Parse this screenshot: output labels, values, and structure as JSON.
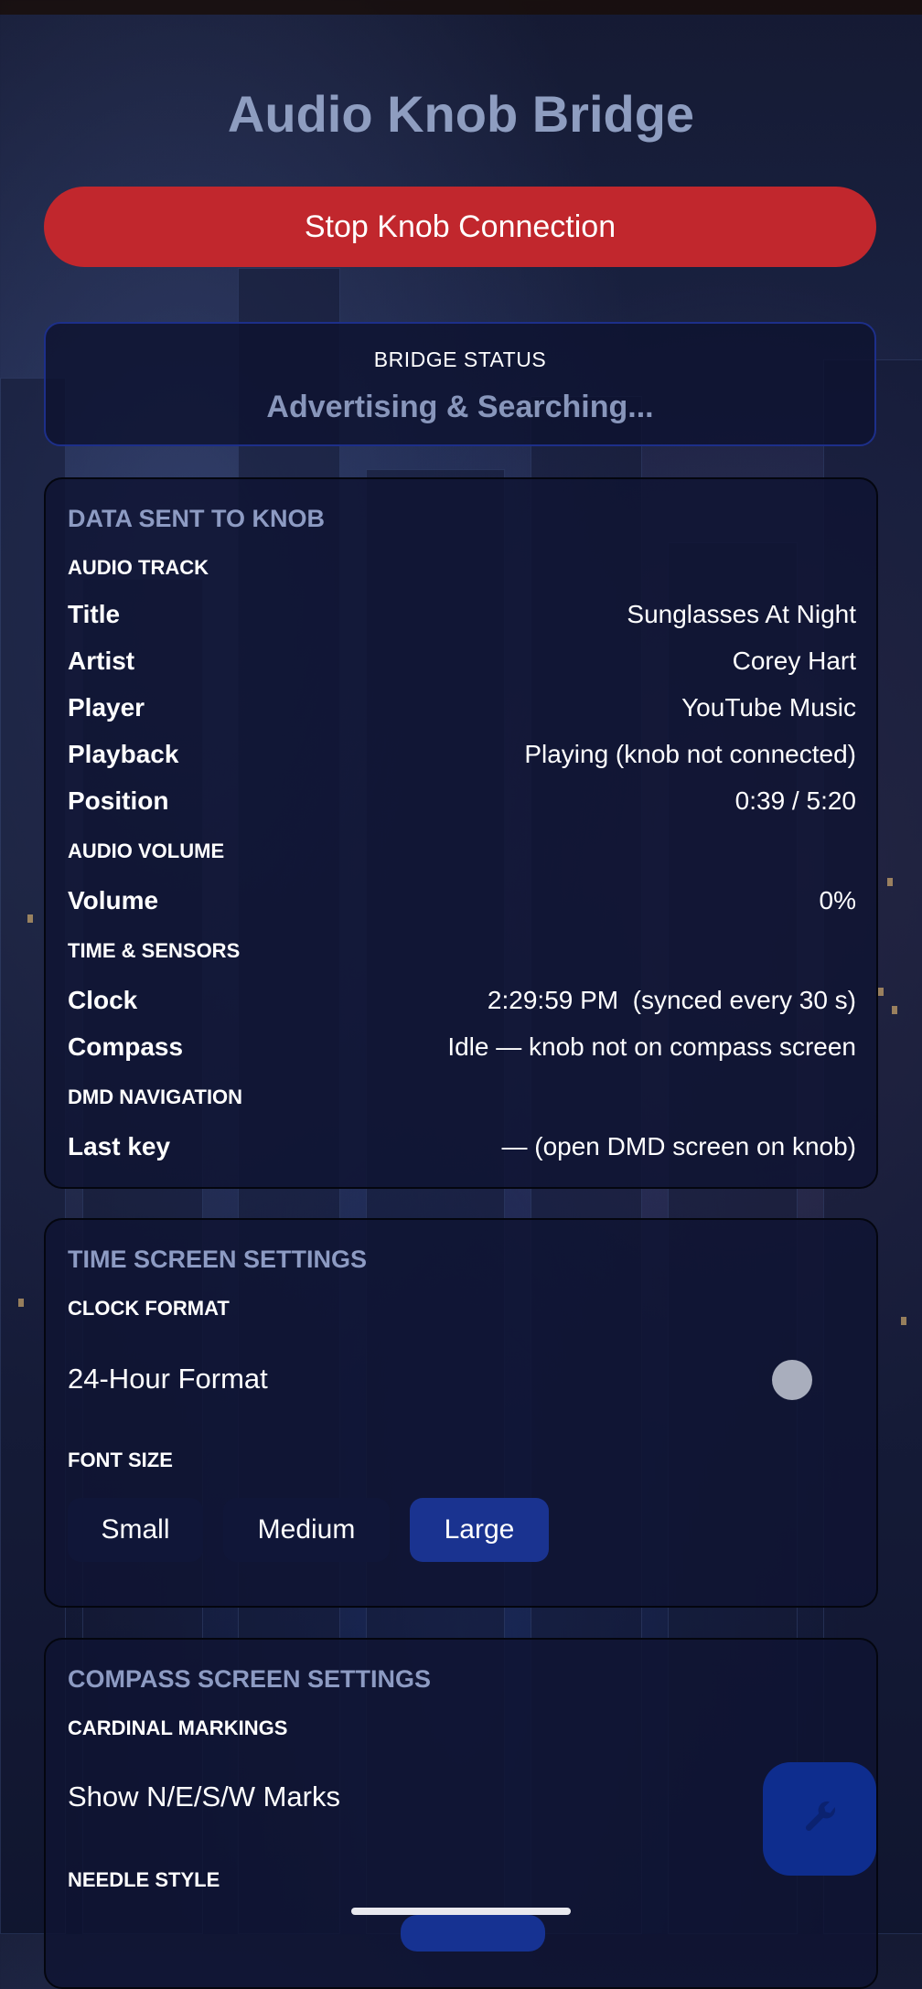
{
  "app": {
    "title": "Audio Knob Bridge",
    "stop_button_label": "Stop Knob Connection"
  },
  "bridge_status": {
    "label": "BRIDGE STATUS",
    "value": "Advertising & Searching..."
  },
  "data_sent": {
    "heading": "DATA SENT TO KNOB",
    "audio_track": {
      "label": "AUDIO TRACK",
      "rows": [
        {
          "label": "Title",
          "value": "Sunglasses At Night"
        },
        {
          "label": "Artist",
          "value": "Corey Hart"
        },
        {
          "label": "Player",
          "value": "YouTube Music"
        },
        {
          "label": "Playback",
          "value": "Playing (knob not connected)"
        },
        {
          "label": "Position",
          "value": "0:39 / 5:20"
        }
      ]
    },
    "audio_volume": {
      "label": "AUDIO VOLUME",
      "rows": [
        {
          "label": "Volume",
          "value": "0%"
        }
      ]
    },
    "time_sensors": {
      "label": "TIME & SENSORS",
      "rows": [
        {
          "label": "Clock",
          "value": "2:29:59 PM  (synced every 30 s)"
        },
        {
          "label": "Compass",
          "value": "Idle — knob not on compass screen"
        }
      ]
    },
    "dmd_navigation": {
      "label": "DMD NAVIGATION",
      "rows": [
        {
          "label": "Last key",
          "value": "— (open DMD screen on knob)"
        }
      ]
    }
  },
  "time_screen": {
    "heading": "TIME SCREEN SETTINGS",
    "clock_format_label": "CLOCK FORMAT",
    "toggle_label": "24-Hour Format",
    "toggle_on": false,
    "font_size_label": "FONT SIZE",
    "font_sizes": [
      {
        "label": "Small",
        "selected": false
      },
      {
        "label": "Medium",
        "selected": false
      },
      {
        "label": "Large",
        "selected": true
      }
    ]
  },
  "compass_screen": {
    "heading": "COMPASS SCREEN SETTINGS",
    "cardinal_label": "CARDINAL MARKINGS",
    "cardinal_toggle_label": "Show N/E/S/W Marks",
    "needle_style_label": "NEEDLE STYLE"
  },
  "fab": {
    "icon": "wrench-icon"
  },
  "colors": {
    "accent_red": "#c1272d",
    "accent_blue": "#1a3390",
    "heading_muted": "#8d9bc3"
  }
}
